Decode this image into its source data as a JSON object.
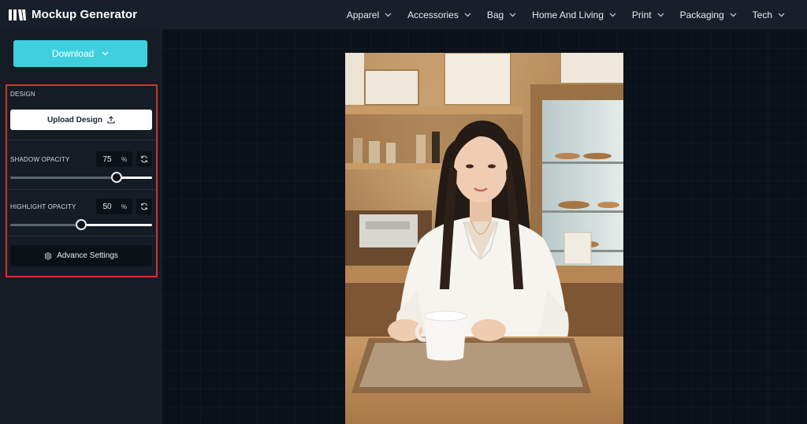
{
  "app": {
    "title": "Mockup Generator"
  },
  "nav": {
    "items": [
      {
        "label": "Apparel"
      },
      {
        "label": "Accessories"
      },
      {
        "label": "Bag"
      },
      {
        "label": "Home And Living"
      },
      {
        "label": "Print"
      },
      {
        "label": "Packaging"
      },
      {
        "label": "Tech"
      }
    ]
  },
  "sidebar": {
    "download_label": "Download",
    "design_section": "DESIGN",
    "upload_label": "Upload Design",
    "shadow": {
      "label": "SHADOW OPACITY",
      "value": "75",
      "unit": "%",
      "level": 0.75
    },
    "highlight": {
      "label": "HIGHLIGHT OPACITY",
      "value": "50",
      "unit": "%",
      "level": 0.5
    },
    "advance_label": "Advance Settings"
  },
  "colors": {
    "accent": "#3ed0df",
    "topbar": "#161f2a",
    "sidebar": "#141c26",
    "canvas": "#0a111b",
    "highlight_border": "#d7322c"
  },
  "icons": {
    "logo": "mockup-generator-logo",
    "chevron": "chevron-down-icon",
    "upload": "upload-icon",
    "reset": "reset-icon",
    "settings": "settings-icon"
  }
}
